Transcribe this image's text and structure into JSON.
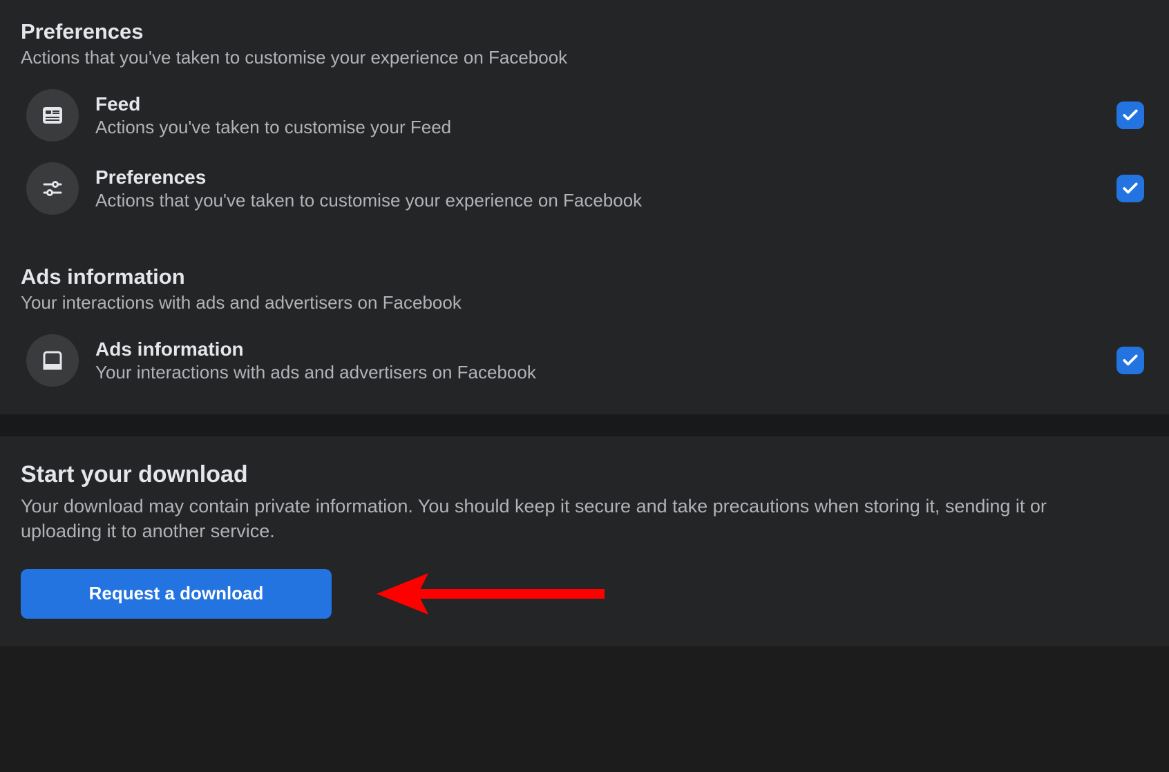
{
  "sections": [
    {
      "title": "Preferences",
      "subtitle": "Actions that you've taken to customise your experience on Facebook",
      "options": [
        {
          "title": "Feed",
          "desc": "Actions you've taken to customise your Feed",
          "icon": "feed-icon",
          "checked": true
        },
        {
          "title": "Preferences",
          "desc": "Actions that you've taken to customise your experience on Facebook",
          "icon": "sliders-icon",
          "checked": true
        }
      ]
    },
    {
      "title": "Ads information",
      "subtitle": "Your interactions with ads and advertisers on Facebook",
      "options": [
        {
          "title": "Ads information",
          "desc": "Your interactions with ads and advertisers on Facebook",
          "icon": "device-icon",
          "checked": true
        }
      ]
    }
  ],
  "download": {
    "title": "Start your download",
    "desc": "Your download may contain private information. You should keep it secure and take precautions when storing it, sending it or uploading it to another service.",
    "button": "Request a download"
  },
  "colors": {
    "accent": "#2374e1",
    "arrow": "#ff0000"
  }
}
